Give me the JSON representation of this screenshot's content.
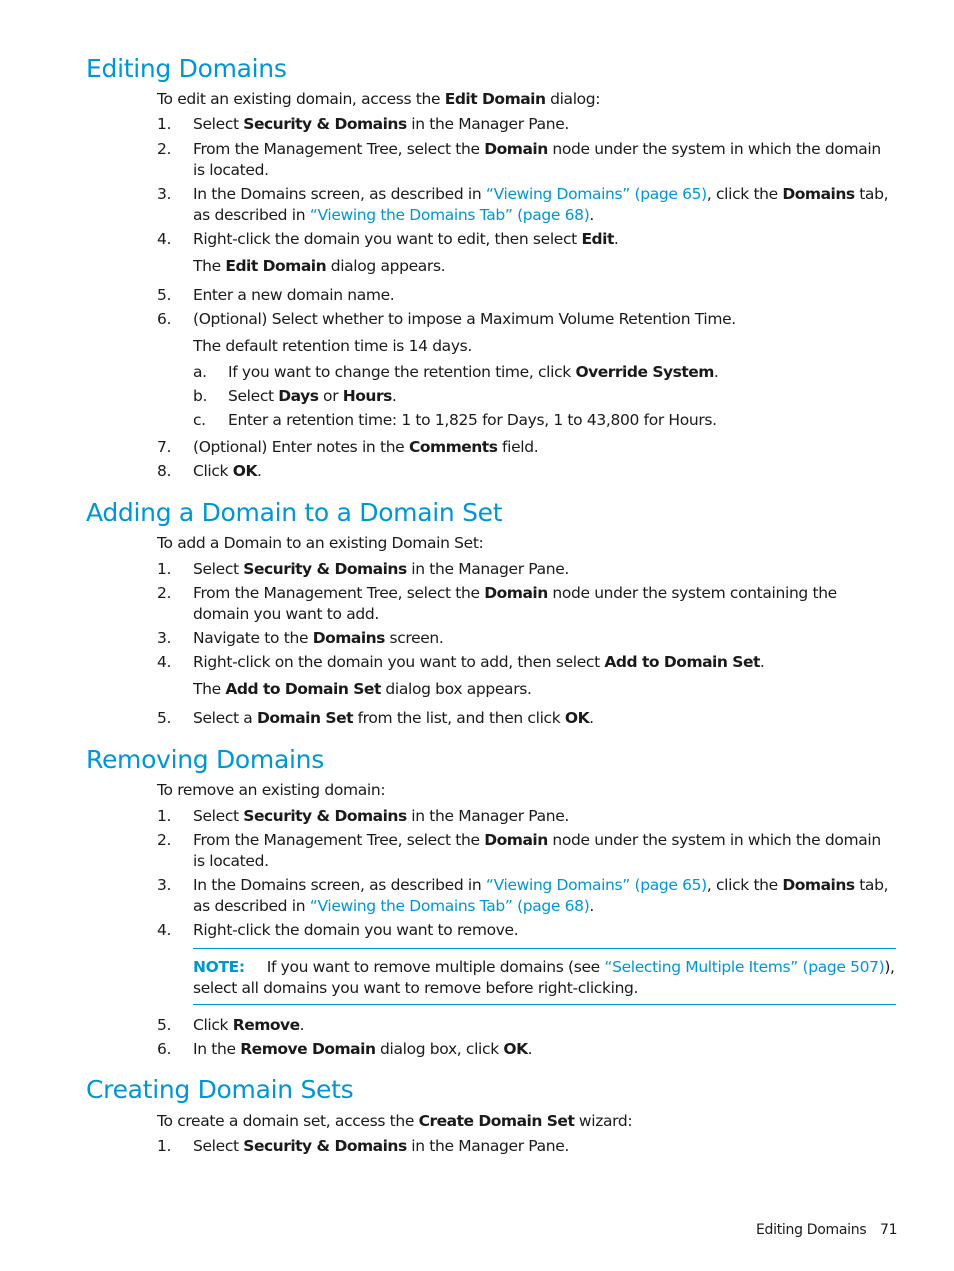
{
  "colors": {
    "accent": "#0096d6",
    "text": "#1a1a1a"
  },
  "sections": {
    "editing": {
      "heading": "Editing Domains",
      "intro_pre": "To edit an existing domain, access the ",
      "intro_bold": "Edit Domain",
      "intro_post": " dialog:",
      "steps": [
        {
          "num": "1.",
          "pre": "Select ",
          "bold": "Security & Domains",
          "post": " in the Manager Pane."
        },
        {
          "num": "2.",
          "pre": "From the Management Tree, select the ",
          "bold": "Domain",
          "post": " node under the system in which the domain is located."
        },
        {
          "num": "3.",
          "pre": "In the Domains screen, as described in ",
          "link1": "“Viewing Domains” (page 65)",
          "mid": ", click the ",
          "bold": "Domains",
          "mid2": " tab, as described in ",
          "link2": "“Viewing the Domains Tab” (page 68)",
          "post": "."
        },
        {
          "num": "4.",
          "pre": "Right-click the domain you want to edit, then select ",
          "bold": "Edit",
          "post": "."
        },
        {
          "num": "5.",
          "text": "Enter a new domain name."
        },
        {
          "num": "6.",
          "text": "(Optional) Select whether to impose a Maximum Volume Retention Time."
        },
        {
          "num": "7.",
          "pre": "(Optional) Enter notes in the ",
          "bold": "Comments",
          "post": " field."
        },
        {
          "num": "8.",
          "pre": "Click ",
          "bold": "OK",
          "post": "."
        }
      ],
      "step4_result_pre": "The ",
      "step4_result_bold": "Edit Domain",
      "step4_result_post": " dialog appears.",
      "step6_note": "The default retention time is 14 days.",
      "substeps": [
        {
          "num": "a.",
          "pre": "If you want to change the retention time, click ",
          "bold": "Override System",
          "post": "."
        },
        {
          "num": "b.",
          "pre": "Select ",
          "bold": "Days",
          "mid": " or ",
          "bold2": "Hours",
          "post": "."
        },
        {
          "num": "c.",
          "text": "Enter a retention time: 1 to 1,825 for Days, 1 to 43,800 for Hours."
        }
      ]
    },
    "adding": {
      "heading": "Adding a Domain to a Domain Set",
      "intro": "To add a Domain to an existing Domain Set:",
      "steps": [
        {
          "num": "1.",
          "pre": "Select ",
          "bold": "Security & Domains",
          "post": " in the Manager Pane."
        },
        {
          "num": "2.",
          "pre": "From the Management Tree, select the ",
          "bold": "Domain",
          "post": " node under the system containing the domain you want to add."
        },
        {
          "num": "3.",
          "pre": "Navigate to the ",
          "bold": "Domains",
          "post": " screen."
        },
        {
          "num": "4.",
          "pre": "Right-click on the domain you want to add, then select ",
          "bold": "Add to Domain Set",
          "post": "."
        },
        {
          "num": "5.",
          "pre": "Select a ",
          "bold": "Domain Set",
          "mid": " from the list, and then click ",
          "bold2": "OK",
          "post": "."
        }
      ],
      "step4_result_pre": "The ",
      "step4_result_bold": "Add to Domain Set",
      "step4_result_post": " dialog box appears."
    },
    "removing": {
      "heading": "Removing Domains",
      "intro": "To remove an existing domain:",
      "steps": [
        {
          "num": "1.",
          "pre": "Select ",
          "bold": "Security & Domains",
          "post": " in the Manager Pane."
        },
        {
          "num": "2.",
          "pre": "From the Management Tree, select the ",
          "bold": "Domain",
          "post": " node under the system in which the domain is located."
        },
        {
          "num": "3.",
          "pre": "In the Domains screen, as described in ",
          "link1": "“Viewing Domains” (page 65)",
          "mid": ", click the ",
          "bold": "Domains",
          "mid2": " tab, as described in ",
          "link2": "“Viewing the Domains Tab” (page 68)",
          "post": "."
        },
        {
          "num": "4.",
          "text": "Right-click the domain you want to remove."
        },
        {
          "num": "5.",
          "pre": "Click ",
          "bold": "Remove",
          "post": "."
        },
        {
          "num": "6.",
          "pre": "In the ",
          "bold": "Remove Domain",
          "mid": " dialog box, click ",
          "bold2": "OK",
          "post": "."
        }
      ],
      "note": {
        "label": "NOTE:",
        "pre": "If you want to remove multiple domains (see ",
        "link": "“Selecting Multiple Items” (page 507)",
        "post": "), select all domains you want to remove before right-clicking."
      }
    },
    "creating": {
      "heading": "Creating Domain Sets",
      "intro_pre": "To create a domain set, access the ",
      "intro_bold": "Create Domain Set",
      "intro_post": " wizard:",
      "steps": [
        {
          "num": "1.",
          "pre": "Select ",
          "bold": "Security & Domains",
          "post": " in the Manager Pane."
        }
      ]
    }
  },
  "footer": {
    "section": "Editing Domains",
    "page": "71"
  }
}
